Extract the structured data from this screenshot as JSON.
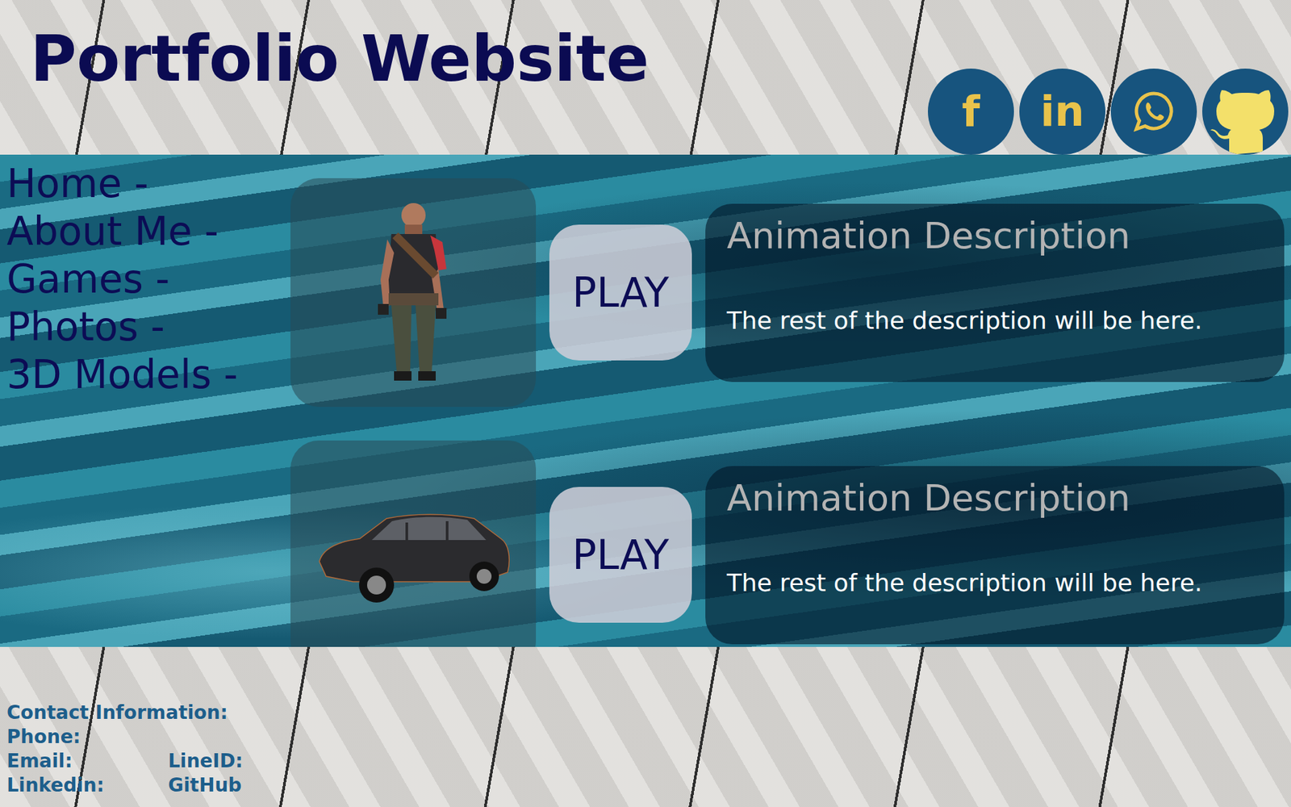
{
  "title": "Portfolio Website",
  "social": [
    {
      "kind": "facebook",
      "glyph": "f"
    },
    {
      "kind": "linkedin",
      "glyph": "in"
    },
    {
      "kind": "whatsapp"
    },
    {
      "kind": "github"
    }
  ],
  "nav": [
    {
      "label": "Home -"
    },
    {
      "label": "About Me -"
    },
    {
      "label": "Games -"
    },
    {
      "label": "Photos -"
    },
    {
      "label": "3D Models -"
    }
  ],
  "cards": [
    {
      "kind": "character",
      "play": "PLAY",
      "heading": "Animation Description",
      "body": "The rest of the description will be here."
    },
    {
      "kind": "car",
      "play": "PLAY",
      "heading": "Animation Description",
      "body": "The rest of the description will be here."
    }
  ],
  "contact": {
    "heading": "Contact Information:",
    "rows": [
      [
        "Phone:"
      ],
      [
        "Email:",
        "LineID:"
      ],
      [
        "Linkedin:",
        "GitHub"
      ]
    ]
  }
}
